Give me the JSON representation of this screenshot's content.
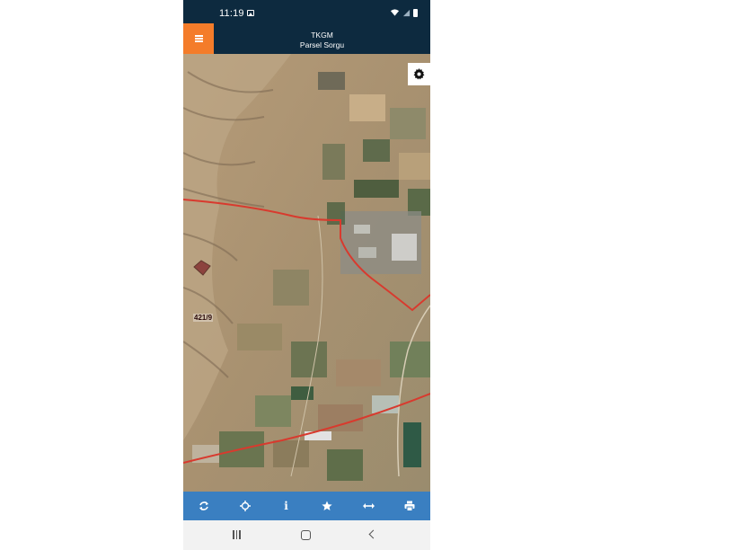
{
  "status_bar": {
    "time": "11:19"
  },
  "header": {
    "title_line1": "TKGM",
    "title_line2": "Parsel Sorgu"
  },
  "map": {
    "parcel_label": "421/9",
    "boundary_color": "#d83a2e"
  },
  "icons": {
    "menu": "menu-icon",
    "settings": "gear-icon",
    "refresh": "refresh-icon",
    "locate": "crosshair-icon",
    "info": "info-icon",
    "favorite": "star-icon",
    "measure": "measure-icon",
    "print": "print-icon"
  },
  "toolbar": {
    "info_glyph": "i"
  },
  "colors": {
    "header": "#0d2a3f",
    "menu_button": "#f47c2a",
    "toolbar": "#3a7fc1"
  }
}
